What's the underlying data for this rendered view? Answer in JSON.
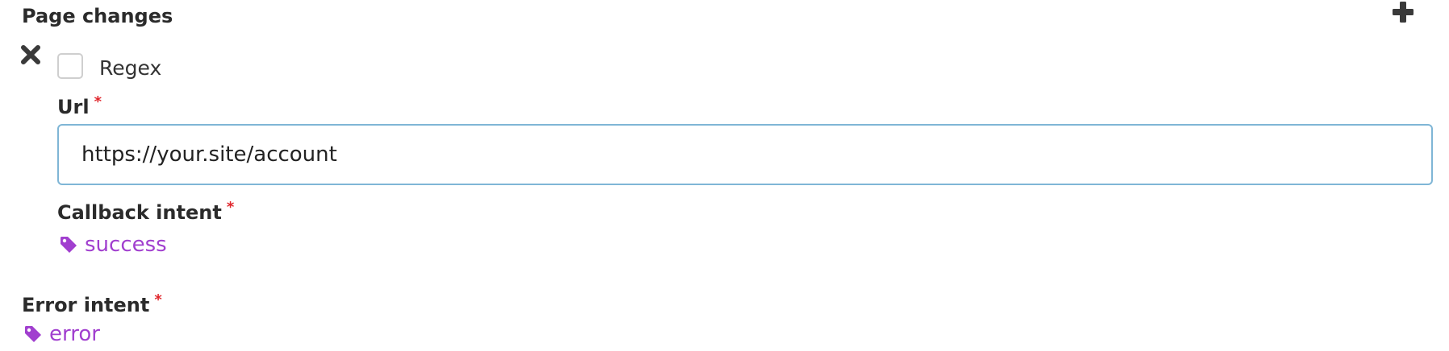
{
  "section": {
    "title": "Page changes",
    "add_icon": "plus-icon",
    "remove_icon": "close-icon"
  },
  "regex": {
    "label": "Regex",
    "checked": false
  },
  "url": {
    "label": "Url",
    "required_mark": "*",
    "value": "https://your.site/account"
  },
  "callback_intent": {
    "label": "Callback intent",
    "required_mark": "*",
    "tag": "success",
    "tag_icon": "tag-icon"
  },
  "error_intent": {
    "label": "Error intent",
    "required_mark": "*",
    "tag": "error",
    "tag_icon": "tag-icon"
  },
  "colors": {
    "tag": "#a13fcf",
    "required": "#e0262c",
    "input_border": "#7fb6d6"
  }
}
